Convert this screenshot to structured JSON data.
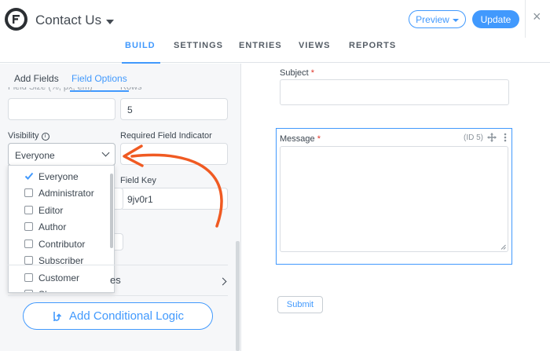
{
  "header": {
    "form_title": "Contact Us",
    "preview_label": "Preview",
    "update_label": "Update",
    "close_symbol": "×",
    "tabs": [
      "BUILD",
      "SETTINGS",
      "ENTRIES",
      "VIEWS",
      "REPORTS"
    ],
    "active_tab": "BUILD"
  },
  "sidebar": {
    "tabs": [
      "Add Fields",
      "Field Options"
    ],
    "active_tab": "Field Options",
    "rows_value": "5",
    "visibility_label": "Visibility",
    "visibility_value": "Everyone",
    "required_indicator_label": "Required Field Indicator",
    "field_key_label": "Field Key",
    "field_key_value": "9jv0r1",
    "visibility_options": [
      {
        "label": "Everyone",
        "checked": true
      },
      {
        "label": "Administrator",
        "checked": false
      },
      {
        "label": "Editor",
        "checked": false
      },
      {
        "label": "Author",
        "checked": false
      },
      {
        "label": "Contributor",
        "checked": false
      },
      {
        "label": "Subscriber",
        "checked": false
      },
      {
        "label": "Customer",
        "checked": false
      },
      {
        "label": "Sh",
        "checked": false
      }
    ],
    "section_partial_label": "es",
    "conditional_logic_label": "Add Conditional Logic"
  },
  "canvas": {
    "subject_label": "Subject",
    "message_label": "Message",
    "required_mark": "*",
    "message_id": "(ID 5)",
    "submit_label": "Submit"
  },
  "colors": {
    "accent": "#4199fd",
    "annotation_arrow": "#f05a22",
    "required": "#e0372c"
  }
}
